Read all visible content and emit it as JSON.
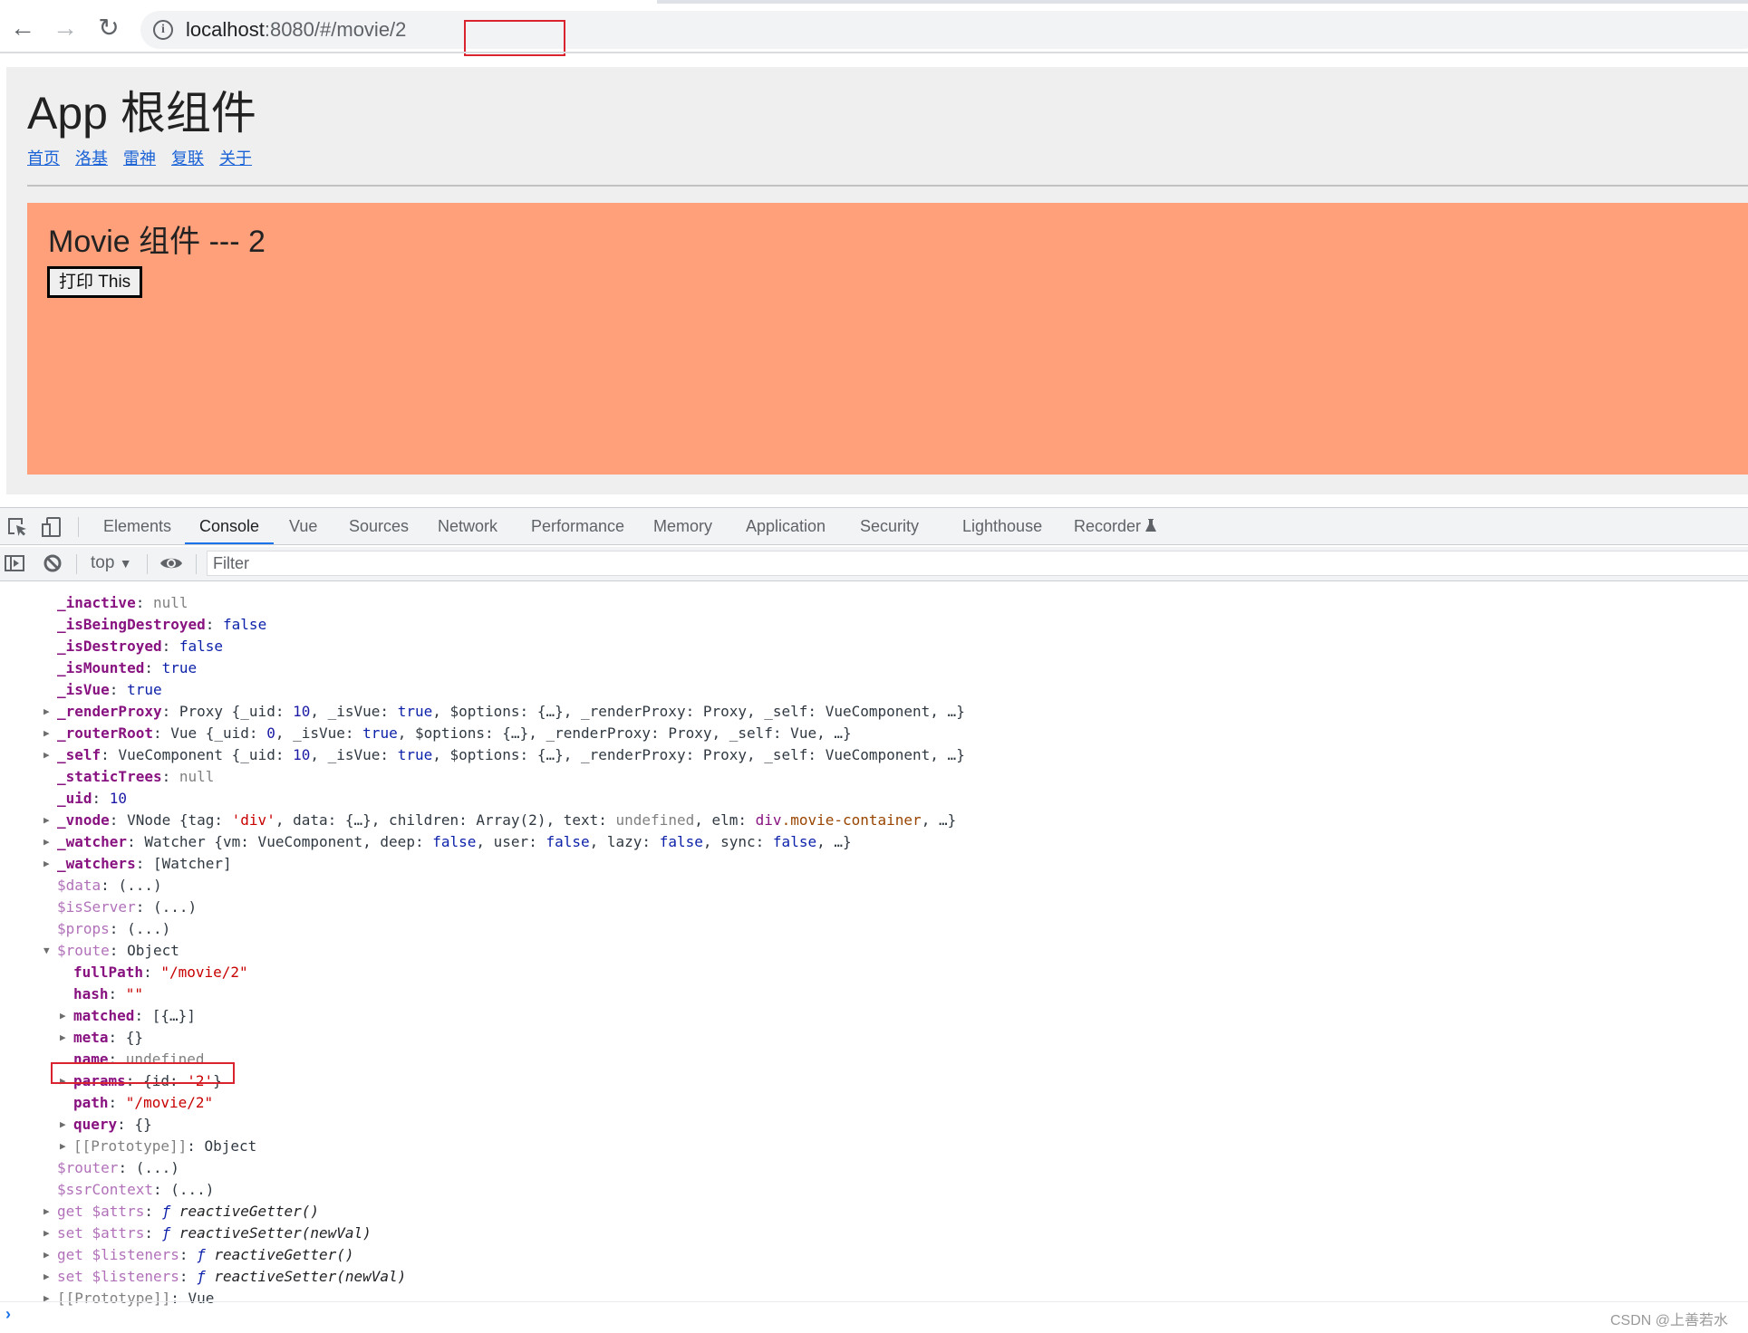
{
  "browser": {
    "url": {
      "host": "localhost",
      "port": ":8080/",
      "hash": "#/movie/2"
    },
    "back_icon": "arrow-left-icon",
    "forward_icon": "arrow-right-icon",
    "reload_icon": "reload-icon",
    "info_icon": "info-icon"
  },
  "app": {
    "title": "App 根组件",
    "nav_links": [
      "首页",
      "洛基",
      "雷神",
      "复联",
      "关于"
    ],
    "movie": {
      "title": "Movie 组件 --- 2",
      "button_label": "打印 This",
      "background_color": "#ffa07a"
    }
  },
  "devtools": {
    "tabs": [
      "Elements",
      "Console",
      "Vue",
      "Sources",
      "Network",
      "Performance",
      "Memory",
      "Application",
      "Security",
      "Lighthouse",
      "Recorder"
    ],
    "active_tab": "Console",
    "context": "top",
    "filter_placeholder": "Filter"
  },
  "console": {
    "lines": [
      {
        "expand": "none",
        "indent": 1,
        "key": "_inactive",
        "keyStyle": "k",
        "parts": [
          [
            "nul",
            "null"
          ]
        ]
      },
      {
        "expand": "none",
        "indent": 1,
        "key": "_isBeingDestroyed",
        "keyStyle": "k",
        "parts": [
          [
            "kw",
            "false"
          ]
        ]
      },
      {
        "expand": "none",
        "indent": 1,
        "key": "_isDestroyed",
        "keyStyle": "k",
        "parts": [
          [
            "kw",
            "false"
          ]
        ]
      },
      {
        "expand": "none",
        "indent": 1,
        "key": "_isMounted",
        "keyStyle": "k",
        "parts": [
          [
            "kw",
            "true"
          ]
        ]
      },
      {
        "expand": "none",
        "indent": 1,
        "key": "_isVue",
        "keyStyle": "k",
        "parts": [
          [
            "kw",
            "true"
          ]
        ]
      },
      {
        "expand": "collapsed",
        "indent": 1,
        "key": "_renderProxy",
        "keyStyle": "k",
        "parts": [
          [
            "plain",
            "Proxy {_uid: "
          ],
          [
            "num",
            "10"
          ],
          [
            "plain",
            ", _isVue: "
          ],
          [
            "kw",
            "true"
          ],
          [
            "plain",
            ", $options: {…}, _renderProxy: Proxy, _self: VueComponent, …}"
          ]
        ]
      },
      {
        "expand": "collapsed",
        "indent": 1,
        "key": "_routerRoot",
        "keyStyle": "k",
        "parts": [
          [
            "plain",
            "Vue {_uid: "
          ],
          [
            "num",
            "0"
          ],
          [
            "plain",
            ", _isVue: "
          ],
          [
            "kw",
            "true"
          ],
          [
            "plain",
            ", $options: {…}, _renderProxy: Proxy, _self: Vue, …}"
          ]
        ]
      },
      {
        "expand": "collapsed",
        "indent": 1,
        "key": "_self",
        "keyStyle": "k",
        "parts": [
          [
            "plain",
            "VueComponent {_uid: "
          ],
          [
            "num",
            "10"
          ],
          [
            "plain",
            ", _isVue: "
          ],
          [
            "kw",
            "true"
          ],
          [
            "plain",
            ", $options: {…}, _renderProxy: Proxy, _self: VueComponent, …}"
          ]
        ]
      },
      {
        "expand": "none",
        "indent": 1,
        "key": "_staticTrees",
        "keyStyle": "k",
        "parts": [
          [
            "nul",
            "null"
          ]
        ]
      },
      {
        "expand": "none",
        "indent": 1,
        "key": "_uid",
        "keyStyle": "k",
        "parts": [
          [
            "num",
            "10"
          ]
        ]
      },
      {
        "expand": "collapsed",
        "indent": 1,
        "key": "_vnode",
        "keyStyle": "k",
        "parts": [
          [
            "plain",
            "VNode {tag: "
          ],
          [
            "s",
            "'div'"
          ],
          [
            "plain",
            ", data: {…}, children: Array(2), text: "
          ],
          [
            "nul",
            "undefined"
          ],
          [
            "plain",
            ", elm: "
          ],
          [
            "dom",
            "div"
          ],
          [
            "domc",
            ".movie-container"
          ],
          [
            "plain",
            ", …}"
          ]
        ]
      },
      {
        "expand": "collapsed",
        "indent": 1,
        "key": "_watcher",
        "keyStyle": "k",
        "parts": [
          [
            "plain",
            "Watcher {vm: VueComponent, deep: "
          ],
          [
            "kw",
            "false"
          ],
          [
            "plain",
            ", user: "
          ],
          [
            "kw",
            "false"
          ],
          [
            "plain",
            ", lazy: "
          ],
          [
            "kw",
            "false"
          ],
          [
            "plain",
            ", sync: "
          ],
          [
            "kw",
            "false"
          ],
          [
            "plain",
            ", …}"
          ]
        ]
      },
      {
        "expand": "collapsed",
        "indent": 1,
        "key": "_watchers",
        "keyStyle": "k",
        "parts": [
          [
            "plain",
            "[Watcher]"
          ]
        ]
      },
      {
        "expand": "none",
        "indent": 1,
        "key": "$data",
        "keyStyle": "kd",
        "parts": [
          [
            "plain",
            "(...)"
          ]
        ]
      },
      {
        "expand": "none",
        "indent": 1,
        "key": "$isServer",
        "keyStyle": "kd",
        "parts": [
          [
            "plain",
            "(...)"
          ]
        ]
      },
      {
        "expand": "none",
        "indent": 1,
        "key": "$props",
        "keyStyle": "kd",
        "parts": [
          [
            "plain",
            "(...)"
          ]
        ]
      },
      {
        "expand": "expanded",
        "indent": 1,
        "key": "$route",
        "keyStyle": "kd",
        "parts": [
          [
            "plain",
            "Object"
          ]
        ]
      },
      {
        "expand": "none",
        "indent": 2,
        "key": "fullPath",
        "keyStyle": "k",
        "parts": [
          [
            "s",
            "\"/movie/2\""
          ]
        ]
      },
      {
        "expand": "none",
        "indent": 2,
        "key": "hash",
        "keyStyle": "k",
        "parts": [
          [
            "s",
            "\"\""
          ]
        ]
      },
      {
        "expand": "collapsed",
        "indent": 2,
        "key": "matched",
        "keyStyle": "k",
        "parts": [
          [
            "plain",
            "[{…}]"
          ]
        ]
      },
      {
        "expand": "collapsed",
        "indent": 2,
        "key": "meta",
        "keyStyle": "k",
        "parts": [
          [
            "plain",
            "{}"
          ]
        ]
      },
      {
        "expand": "none",
        "indent": 2,
        "key": "name",
        "keyStyle": "k",
        "parts": [
          [
            "nul",
            "undefined"
          ]
        ]
      },
      {
        "expand": "collapsed",
        "indent": 2,
        "key": "params",
        "keyStyle": "k",
        "parts": [
          [
            "plain",
            "{id: "
          ],
          [
            "s",
            "'2'"
          ],
          [
            "plain",
            "}"
          ]
        ],
        "highlighted": true
      },
      {
        "expand": "none",
        "indent": 2,
        "key": "path",
        "keyStyle": "k",
        "parts": [
          [
            "s",
            "\"/movie/2\""
          ]
        ]
      },
      {
        "expand": "collapsed",
        "indent": 2,
        "key": "query",
        "keyStyle": "k",
        "parts": [
          [
            "plain",
            "{}"
          ]
        ]
      },
      {
        "expand": "collapsed",
        "indent": 2,
        "key": "[[Prototype]]",
        "keyStyle": "nul",
        "parts": [
          [
            "plain",
            "Object"
          ]
        ]
      },
      {
        "expand": "none",
        "indent": 1,
        "key": "$router",
        "keyStyle": "kd",
        "parts": [
          [
            "plain",
            "(...)"
          ]
        ]
      },
      {
        "expand": "none",
        "indent": 1,
        "key": "$ssrContext",
        "keyStyle": "kd",
        "parts": [
          [
            "plain",
            "(...)"
          ]
        ]
      },
      {
        "expand": "collapsed",
        "indent": 1,
        "key": "get $attrs",
        "keyStyle": "kd",
        "parts": [
          [
            "fn",
            "ƒ "
          ],
          [
            "it",
            "reactiveGetter()"
          ]
        ]
      },
      {
        "expand": "collapsed",
        "indent": 1,
        "key": "set $attrs",
        "keyStyle": "kd",
        "parts": [
          [
            "fn",
            "ƒ "
          ],
          [
            "it",
            "reactiveSetter(newVal)"
          ]
        ]
      },
      {
        "expand": "collapsed",
        "indent": 1,
        "key": "get $listeners",
        "keyStyle": "kd",
        "parts": [
          [
            "fn",
            "ƒ "
          ],
          [
            "it",
            "reactiveGetter()"
          ]
        ]
      },
      {
        "expand": "collapsed",
        "indent": 1,
        "key": "set $listeners",
        "keyStyle": "kd",
        "parts": [
          [
            "fn",
            "ƒ "
          ],
          [
            "it",
            "reactiveSetter(newVal)"
          ]
        ]
      },
      {
        "expand": "collapsed",
        "indent": 1,
        "key": "[[Prototype]]",
        "keyStyle": "nul",
        "parts": [
          [
            "plain",
            "Vue"
          ]
        ]
      }
    ],
    "prompt_symbol": "›"
  },
  "watermark": "CSDN @上善若水",
  "colors": {
    "highlight_red": "#d9232e",
    "link_blue": "#1a62d6",
    "active_tab_underline": "#1a73e8"
  }
}
